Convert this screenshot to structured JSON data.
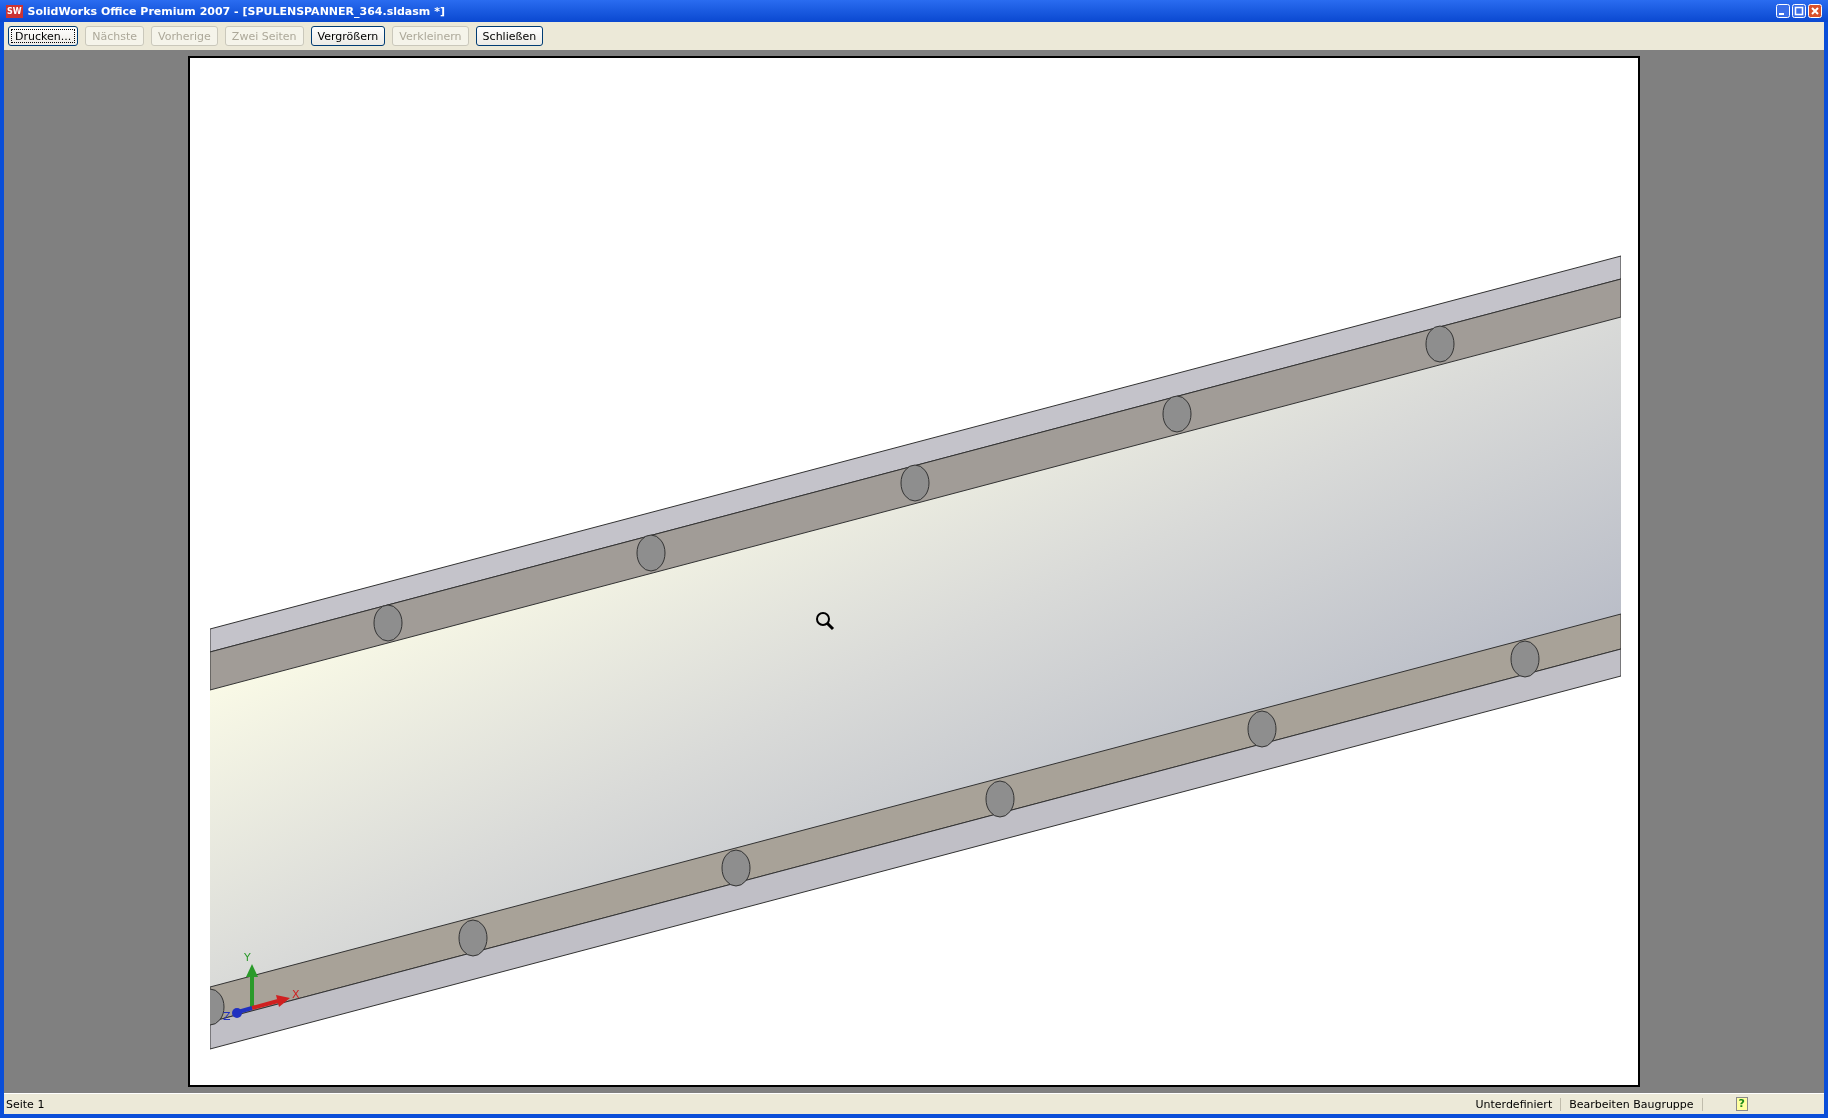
{
  "window": {
    "title": "SolidWorks Office Premium 2007 - [SPULENSPANNER_364.sldasm *]",
    "app_icon": "SW"
  },
  "toolbar": [
    {
      "label": "Drucken...",
      "disabled": false,
      "focused": true
    },
    {
      "label": "Nächste",
      "disabled": true,
      "focused": false
    },
    {
      "label": "Vorherige",
      "disabled": true,
      "focused": false
    },
    {
      "label": "Zwei Seiten",
      "disabled": true,
      "focused": false
    },
    {
      "label": "Vergrößern",
      "disabled": false,
      "focused": false
    },
    {
      "label": "Verkleinern",
      "disabled": true,
      "focused": false
    },
    {
      "label": "Schließen",
      "disabled": false,
      "focused": false
    }
  ],
  "preview": {
    "triad": {
      "x": "X",
      "y": "Y",
      "z": "Z"
    }
  },
  "status_bar": {
    "page": "Seite 1",
    "state": "Unterdefiniert",
    "mode": "Bearbeiten Baugruppe",
    "help": "?"
  }
}
